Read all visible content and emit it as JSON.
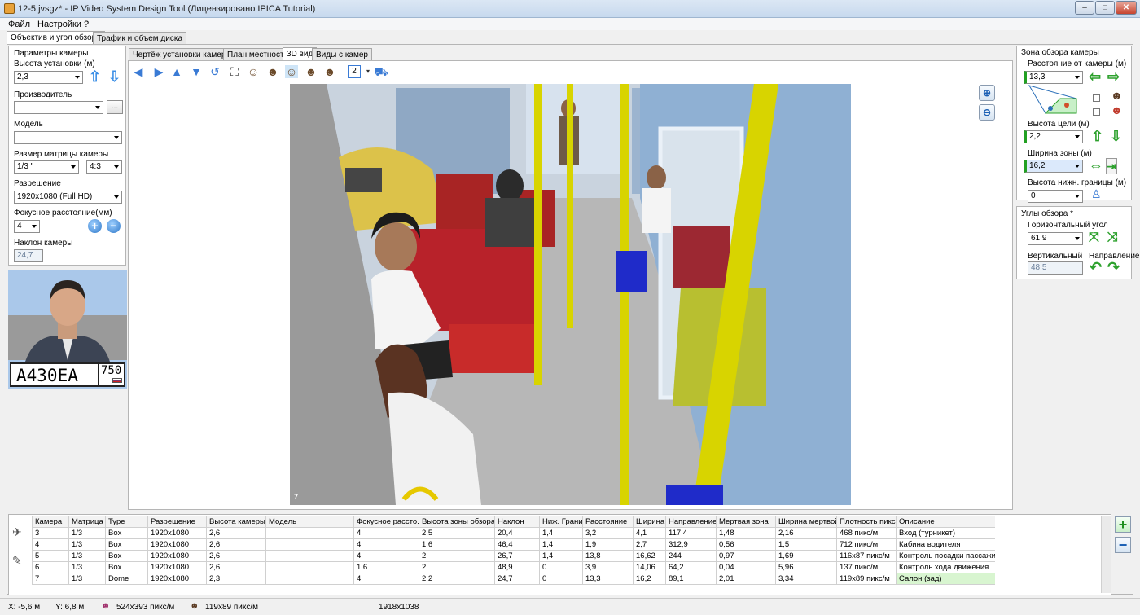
{
  "window": {
    "title": "12-5.jvsgz* - IP Video System Design Tool (Лицензировано  IPICA Tutorial)",
    "min": "–",
    "max": "□",
    "close": "✕"
  },
  "menu": [
    "Файл",
    "Настройки",
    "?"
  ],
  "main_tabs": [
    "Объектив и угол обзора",
    "Трафик и объем диска"
  ],
  "left": {
    "section": "Параметры камеры",
    "height_label": "Высота установки (м)",
    "height_value": "2,3",
    "manufacturer_label": "Производитель",
    "manufacturer_value": "",
    "browse": "...",
    "model_label": "Модель",
    "model_value": "",
    "sensor_label": "Размер матрицы камеры",
    "sensor_value": "1/3 \"",
    "aspect_value": "4:3",
    "resolution_label": "Разрешение",
    "resolution_value": "1920x1080 (Full HD)",
    "focal_label": "Фокусное расстояние(мм)",
    "focal_value": "4",
    "tilt_label": "Наклон камеры",
    "tilt_value": "24,7",
    "plate_text": "А430ЕА",
    "plate_region": "750"
  },
  "view_tabs": [
    "Чертёж установки камеры",
    "План местности",
    "3D вид",
    "Виды с камер"
  ],
  "toolbar": {
    "layout_value": "2"
  },
  "scene": {
    "label": "7"
  },
  "right": {
    "zone_title": "Зона обзора камеры",
    "distance_label": "Расстояние от камеры (м)",
    "distance_value": "13,3",
    "target_height_label": "Высота цели (м)",
    "target_height_value": "2,2",
    "zone_width_label": "Ширина зоны (м)",
    "zone_width_value": "16,2",
    "lower_label": "Высота нижн. границы (м)",
    "lower_value": "0",
    "angles_title": "Углы обзора *",
    "horiz_label": "Горизонтальный угол",
    "horiz_value": "61,9",
    "vert_label": "Вертикальный",
    "vert_value": "48,5",
    "direction_label": "Направление"
  },
  "table": {
    "columns": [
      "Камера",
      "Матрица",
      "Type",
      "Разрешение",
      "Высота камеры",
      "Модель",
      "Фокусное рассто...",
      "Высота зоны обзора",
      "Наклон",
      "Ниж. Граница",
      "Расстояние",
      "Ширина ...",
      "Направление",
      "Мертвая зона",
      "Ширина мертвой...",
      "Плотность пикс...",
      "Описание"
    ],
    "rows": [
      [
        "3",
        "1/3",
        "Box",
        "1920x1080",
        "2,6",
        "",
        "4",
        "2,5",
        "20,4",
        "1,4",
        "3,2",
        "4,1",
        "117,4",
        "1,48",
        "2,16",
        "468 пикс/м",
        "Вход (турникет)"
      ],
      [
        "4",
        "1/3",
        "Box",
        "1920x1080",
        "2,6",
        "",
        "4",
        "1,6",
        "46,4",
        "1,4",
        "1,9",
        "2,7",
        "312,9",
        "0,56",
        "1,5",
        "712 пикс/м",
        "Кабина водителя"
      ],
      [
        "5",
        "1/3",
        "Box",
        "1920x1080",
        "2,6",
        "",
        "4",
        "2",
        "26,7",
        "1,4",
        "13,8",
        "16,62",
        "244",
        "0,97",
        "1,69",
        "116x87 пикс/м",
        "Контроль посадки пассажиров"
      ],
      [
        "6",
        "1/3",
        "Box",
        "1920x1080",
        "2,6",
        "",
        "1,6",
        "2",
        "48,9",
        "0",
        "3,9",
        "14,06",
        "64,2",
        "0,04",
        "5,96",
        "137 пикс/м",
        "Контроль хода движения"
      ],
      [
        "7",
        "1/3",
        "Dome",
        "1920x1080",
        "2,3",
        "",
        "4",
        "2,2",
        "24,7",
        "0",
        "13,3",
        "16,2",
        "89,1",
        "2,01",
        "3,34",
        "119x89 пикс/м",
        "Салон (зад)"
      ]
    ]
  },
  "status": {
    "x": "X: -5,6 м",
    "y": "Y: 6,8 м",
    "density1": "524x393 пикс/м",
    "density2": "119x89 пикс/м",
    "size": "1918x1038"
  }
}
